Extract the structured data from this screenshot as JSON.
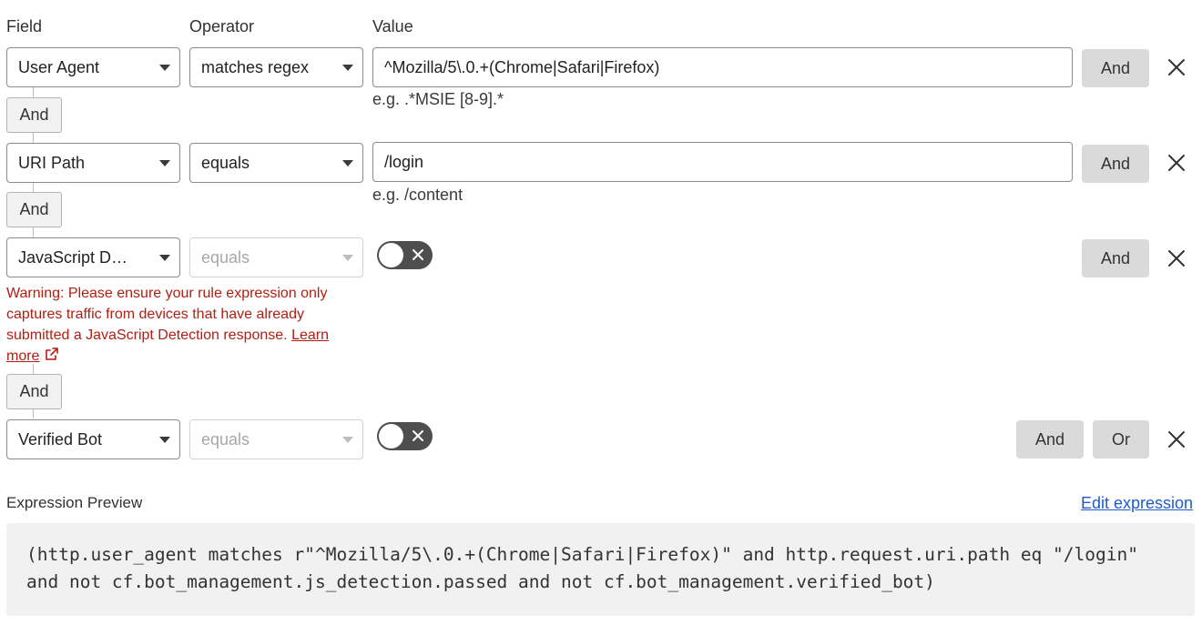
{
  "headers": {
    "field": "Field",
    "operator": "Operator",
    "value": "Value"
  },
  "rows": [
    {
      "field": "User Agent",
      "operator": "matches regex",
      "value": "^Mozilla/5\\.0.+(Chrome|Safari|Firefox)",
      "hint": "e.g. .*MSIE [8-9].*",
      "and_label": "And"
    },
    {
      "field": "URI Path",
      "operator": "equals",
      "value": "/login",
      "hint": "e.g. /content",
      "and_label": "And"
    },
    {
      "field": "JavaScript Detection",
      "operator": "equals",
      "toggle": false,
      "and_label": "And",
      "warning": {
        "text": "Warning: Please ensure your rule expression only captures traffic from devices that have already submitted a JavaScript Detection response.",
        "link_label": "Learn more"
      }
    },
    {
      "field": "Verified Bot",
      "operator": "equals",
      "toggle": false,
      "and_label": "And",
      "or_label": "Or"
    }
  ],
  "connectors": [
    "And",
    "And",
    "And"
  ],
  "preview": {
    "label": "Expression Preview",
    "edit_label": "Edit expression",
    "expression": "(http.user_agent matches r\"^Mozilla/5\\.0.+(Chrome|Safari|Firefox)\" and http.request.uri.path eq \"/login\" and not cf.bot_management.js_detection.passed and not cf.bot_management.verified_bot)"
  },
  "colors": {
    "warning": "#b11e12",
    "link": "#1f5bcc",
    "toggle_off": "#4e4e4e"
  },
  "icons": {
    "close": "close-icon",
    "caret": "chevron-down-icon",
    "external": "external-link-icon"
  }
}
